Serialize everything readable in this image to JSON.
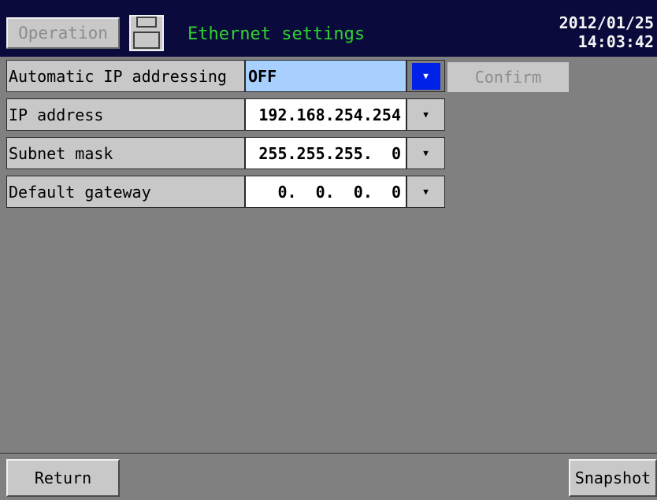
{
  "header": {
    "operation_label": "Operation",
    "title": "Ethernet settings",
    "date": "2012/01/25",
    "time": "14:03:42",
    "save_icon": "floppy-disk-icon"
  },
  "settings": [
    {
      "label": "Automatic IP addressing",
      "value": "OFF"
    },
    {
      "label": "IP address",
      "value": "192.168.254.254"
    },
    {
      "label": "Subnet mask",
      "value": "255.255.255.  0"
    },
    {
      "label": "Default gateway",
      "value": "  0.  0.  0.  0"
    }
  ],
  "confirm_label": "Confirm",
  "footer": {
    "return_label": "Return",
    "snapshot_label": "Snapshot"
  },
  "colors": {
    "header_bg": "#0a0a3c",
    "title": "#2ed42e",
    "selected_value_bg": "#a7d0ff",
    "active_dropdown": "#0022e6",
    "panel_bg": "#808080"
  }
}
